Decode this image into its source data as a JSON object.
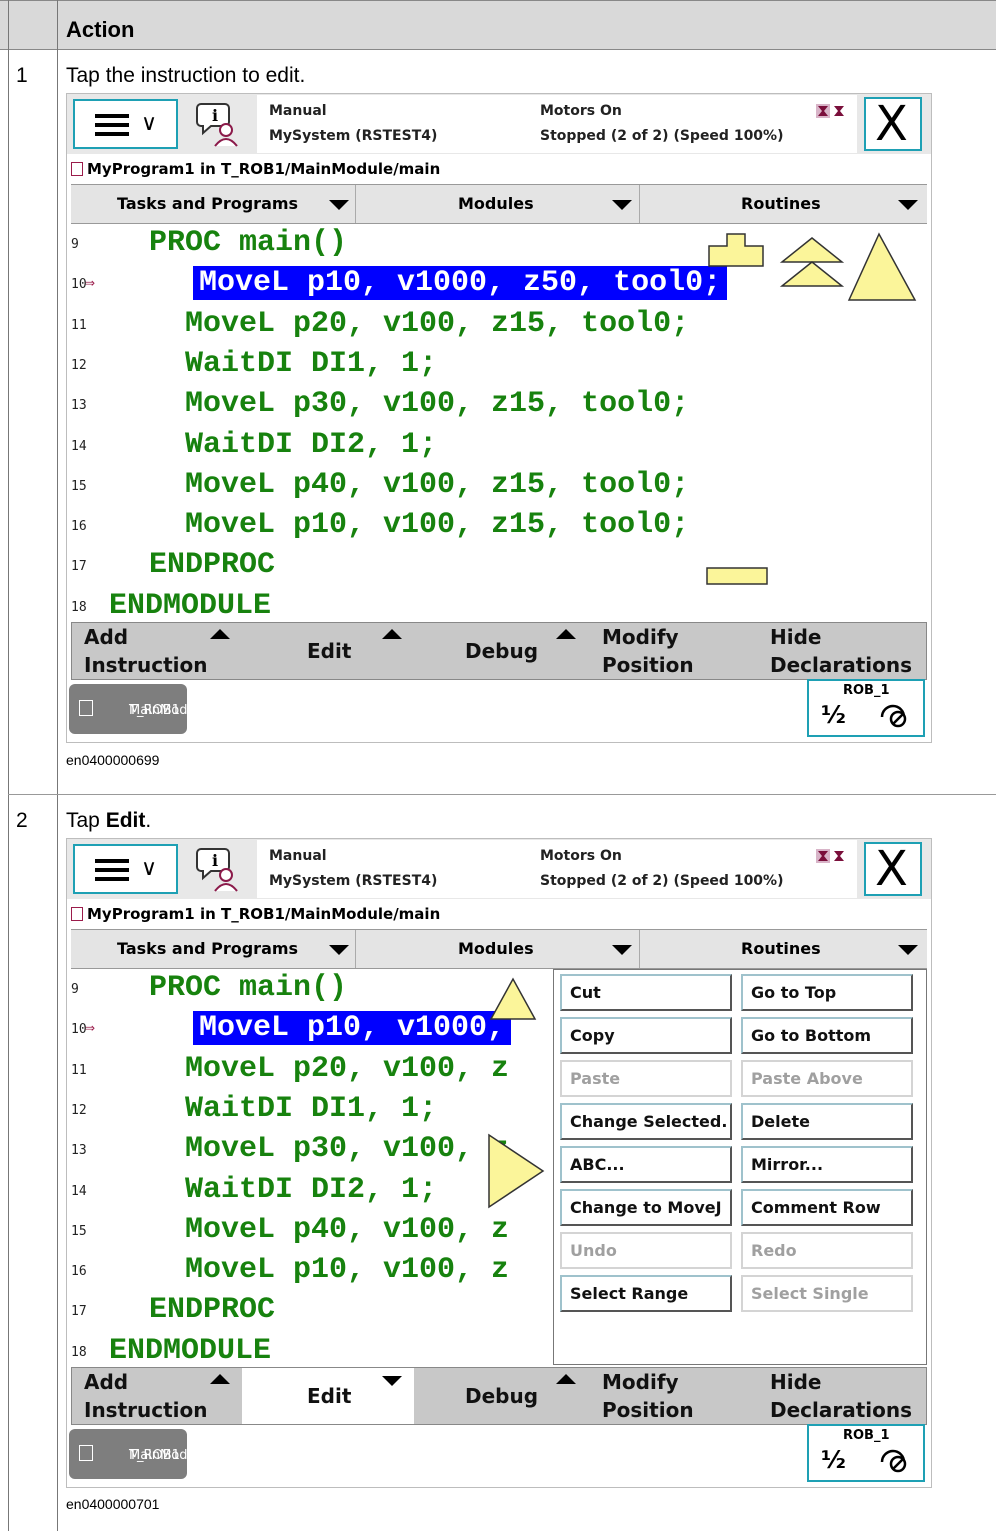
{
  "table": {
    "header": "Action",
    "steps": [
      {
        "num": "1",
        "text": "Tap the instruction to edit.",
        "fig_id": "en0400000699"
      },
      {
        "num": "2",
        "text_pre": "Tap ",
        "text_bold": "Edit",
        "text_post": ".",
        "fig_id": "en0400000701"
      }
    ]
  },
  "screen": {
    "status": {
      "mode": "Manual",
      "system": "MySystem (RSTEST4)",
      "motors": "Motors On",
      "state": "Stopped (2 of 2) (Speed 100%)"
    },
    "close_symbol": "X",
    "path": "MyProgram1 in T_ROB1/MainModule/main",
    "tabs": [
      "Tasks and Programs",
      "Modules",
      "Routines"
    ],
    "code_lines": [
      {
        "num": "9",
        "text": "PROC main()"
      },
      {
        "num": "10",
        "text": "MoveL p10, v1000, z50, tool0;"
      },
      {
        "num": "11",
        "text": "MoveL p20, v100, z15, tool0;"
      },
      {
        "num": "12",
        "text": "WaitDI DI1, 1;"
      },
      {
        "num": "13",
        "text": "MoveL p30, v100, z15, tool0;"
      },
      {
        "num": "14",
        "text": "WaitDI DI2, 1;"
      },
      {
        "num": "15",
        "text": "MoveL p40, v100, z15, tool0;"
      },
      {
        "num": "16",
        "text": "MoveL p10, v100, z15, tool0;"
      },
      {
        "num": "17",
        "text": "ENDPROC"
      },
      {
        "num": "18",
        "text": "ENDMODULE"
      }
    ],
    "code_lines_2": [
      {
        "num": "9",
        "text": "PROC main()"
      },
      {
        "num": "10",
        "text": "MoveL p10, v1000,"
      },
      {
        "num": "11",
        "text": "MoveL p20, v100, z"
      },
      {
        "num": "12",
        "text": "WaitDI DI1, 1;"
      },
      {
        "num": "13",
        "text": "MoveL p30, v100, z"
      },
      {
        "num": "14",
        "text": "WaitDI DI2, 1;"
      },
      {
        "num": "15",
        "text": "MoveL p40, v100, z"
      },
      {
        "num": "16",
        "text": "MoveL p10, v100, z"
      },
      {
        "num": "17",
        "text": "ENDPROC"
      },
      {
        "num": "18",
        "text": "ENDMODULE"
      }
    ],
    "bottom": {
      "add_1": "Add",
      "add_2": "Instruction",
      "edit": "Edit",
      "debug": "Debug",
      "modify_1": "Modify",
      "modify_2": "Position",
      "hide_1": "Hide",
      "hide_2": "Declarations"
    },
    "task_1": "T_ROB1",
    "task_2": "MainMod...",
    "rob_label": "ROB_1",
    "rob_frac": "½",
    "edit_menu": [
      {
        "label": "Cut",
        "enabled": true
      },
      {
        "label": "Go to Top",
        "enabled": true
      },
      {
        "label": "Copy",
        "enabled": true
      },
      {
        "label": "Go to Bottom",
        "enabled": true
      },
      {
        "label": "Paste",
        "enabled": false
      },
      {
        "label": "Paste Above",
        "enabled": false
      },
      {
        "label": "Change Selected.",
        "enabled": true
      },
      {
        "label": "Delete",
        "enabled": true
      },
      {
        "label": "ABC...",
        "enabled": true
      },
      {
        "label": "Mirror...",
        "enabled": true
      },
      {
        "label": "Change to MoveJ",
        "enabled": true
      },
      {
        "label": "Comment Row",
        "enabled": true
      },
      {
        "label": "Undo",
        "enabled": false
      },
      {
        "label": "Redo",
        "enabled": false
      },
      {
        "label": "Select Range",
        "enabled": true
      },
      {
        "label": "Select Single",
        "enabled": false
      }
    ]
  }
}
